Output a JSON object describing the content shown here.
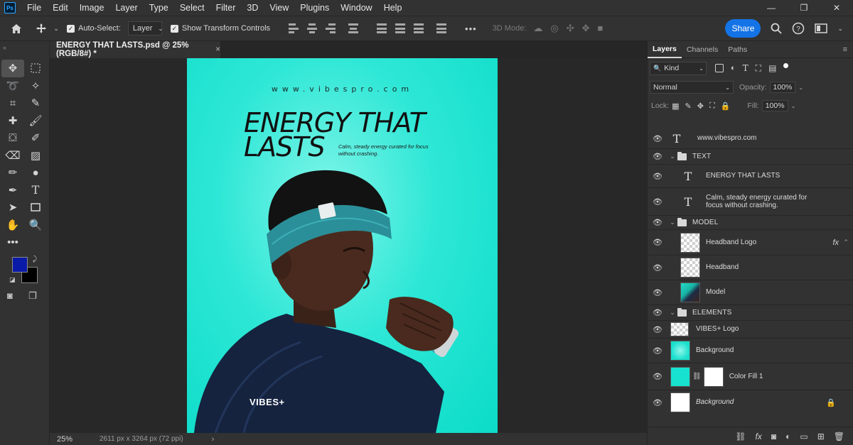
{
  "menu": [
    "File",
    "Edit",
    "Image",
    "Layer",
    "Type",
    "Select",
    "Filter",
    "3D",
    "View",
    "Plugins",
    "Window",
    "Help"
  ],
  "app_logo": "Ps",
  "window_controls": [
    "—",
    "❐",
    "✕"
  ],
  "options": {
    "auto_select_label": "Auto-Select:",
    "auto_select_target": "Layer",
    "show_transform_label": "Show Transform Controls",
    "mode_3d_label": "3D Mode:",
    "more": "•••",
    "share_label": "Share"
  },
  "document": {
    "tab_title": "ENERGY THAT LASTS.psd @ 25% (RGB/8#) *",
    "tab_close": "×",
    "zoom": "25%",
    "dimensions": "2611 px x 3264 px (72 ppi)",
    "status_arrow": "›"
  },
  "poster": {
    "url": "www.vibespro.com",
    "title_line1": "ENERGY THAT",
    "title_line2": "LASTS",
    "subtitle": "Calm, steady energy curated for focus without crashing.",
    "brand": "VIBES+"
  },
  "colors": {
    "foreground": "#0a1aa8",
    "background": "#000000",
    "accent": "#1473e6",
    "poster_teal": "#17e2cf"
  },
  "panel": {
    "tabs": [
      "Layers",
      "Channels",
      "Paths"
    ],
    "kind_label": "Kind",
    "blend_mode": "Normal",
    "opacity_label": "Opacity:",
    "opacity_value": "100%",
    "lock_label": "Lock:",
    "fill_label": "Fill:",
    "fill_value": "100%"
  },
  "layers": [
    {
      "name": "www.vibespro.com",
      "type": "text"
    },
    {
      "name": "TEXT",
      "type": "group"
    },
    {
      "name": "ENERGY THAT LASTS",
      "type": "text"
    },
    {
      "name": "Calm, steady energy curated for focus without crashing.",
      "type": "text"
    },
    {
      "name": "MODEL",
      "type": "group"
    },
    {
      "name": "Headband Logo",
      "type": "image",
      "fx": "fx"
    },
    {
      "name": "Headband",
      "type": "image"
    },
    {
      "name": "Model",
      "type": "image"
    },
    {
      "name": "ELEMENTS",
      "type": "group"
    },
    {
      "name": "VIBES+ Logo",
      "type": "image"
    },
    {
      "name": "Background",
      "type": "image"
    },
    {
      "name": "Color Fill 1",
      "type": "fill"
    },
    {
      "name": "Background",
      "type": "locked"
    }
  ]
}
